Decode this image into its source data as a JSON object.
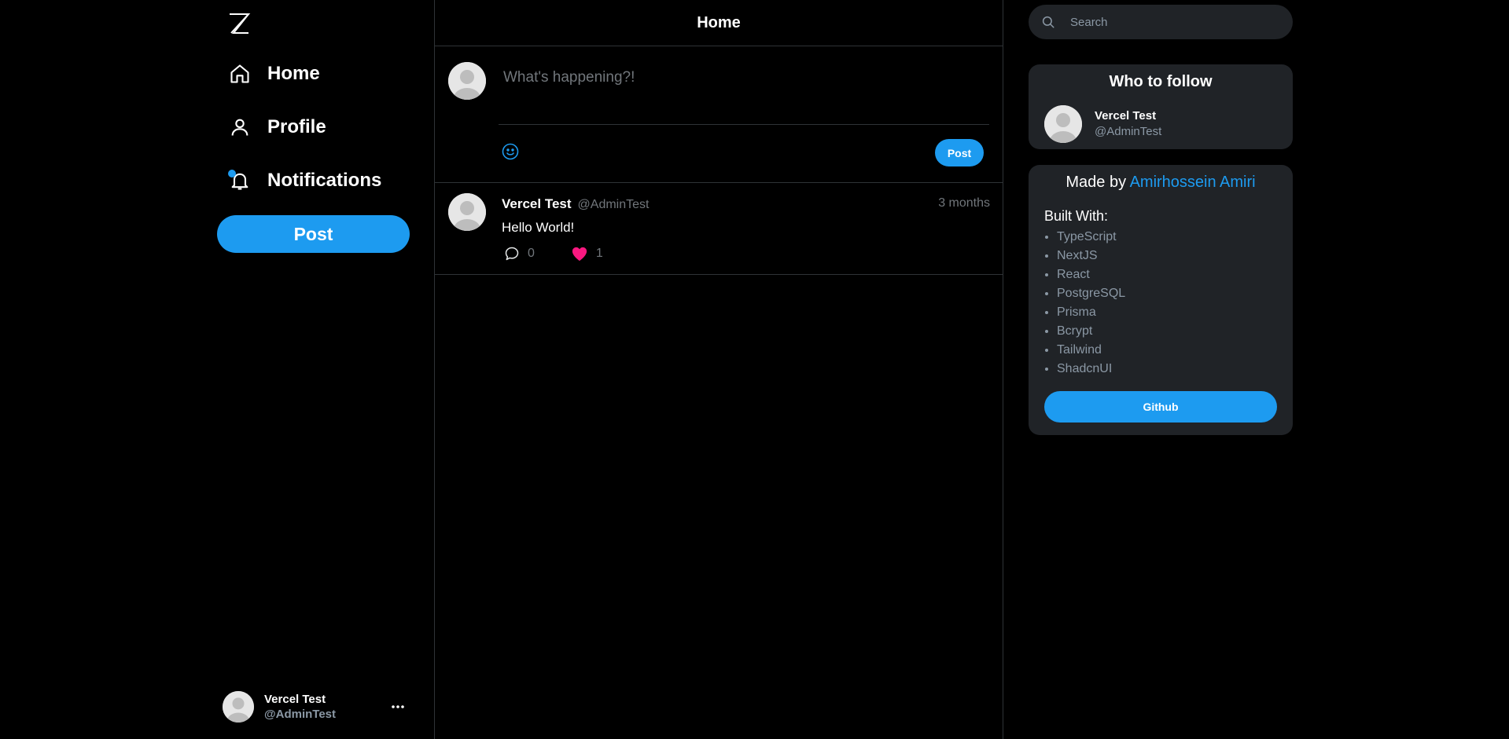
{
  "colors": {
    "background": "#000000",
    "accent": "#1d9bf0",
    "like": "#f91880",
    "card": "#202327",
    "border": "#2f3336",
    "muted": "#71767b"
  },
  "sidebar": {
    "logo_icon": "z-logo-icon",
    "items": [
      {
        "label": "Home",
        "icon": "home-icon"
      },
      {
        "label": "Profile",
        "icon": "user-icon"
      },
      {
        "label": "Notifications",
        "icon": "bell-icon"
      }
    ],
    "post_label": "Post",
    "account": {
      "name": "Vercel Test",
      "handle": "@AdminTest",
      "more_icon": "more-dots-icon"
    }
  },
  "main": {
    "title": "Home",
    "composer": {
      "placeholder": "What's happening?!",
      "post_label": "Post",
      "emoji_icon": "emoji-icon"
    },
    "posts": [
      {
        "name": "Vercel Test",
        "handle": "@AdminTest",
        "time": "3 months",
        "text": "Hello World!",
        "comments": "0",
        "likes": "1",
        "liked": true
      }
    ]
  },
  "right": {
    "search": {
      "placeholder": "Search",
      "icon": "search-icon"
    },
    "who_to_follow": {
      "title": "Who to follow",
      "users": [
        {
          "name": "Vercel Test",
          "handle": "@AdminTest"
        }
      ]
    },
    "made_by": {
      "prefix": "Made by",
      "author": "Amirhossein Amiri",
      "built_with_title": "Built With:",
      "tech": [
        "TypeScript",
        "NextJS",
        "React",
        "PostgreSQL",
        "Prisma",
        "Bcrypt",
        "Tailwind",
        "ShadcnUI"
      ],
      "github_label": "Github"
    }
  }
}
